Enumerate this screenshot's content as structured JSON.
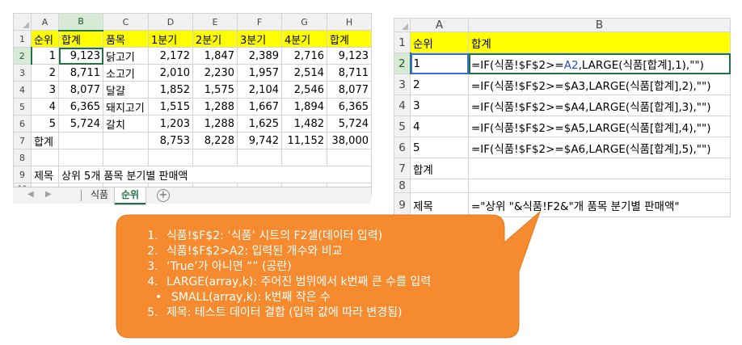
{
  "left_sheet": {
    "columns": [
      "A",
      "B",
      "C",
      "D",
      "E",
      "F",
      "G",
      "H"
    ],
    "rows": [
      {
        "num": "1",
        "cells": [
          "순위",
          "합계",
          "품목",
          "1분기",
          "2분기",
          "3분기",
          "4분기",
          "합계"
        ]
      },
      {
        "num": "2",
        "cells": [
          "1",
          "9,123",
          "닭고기",
          "2,172",
          "1,847",
          "2,389",
          "2,716",
          "9,123"
        ]
      },
      {
        "num": "3",
        "cells": [
          "2",
          "8,711",
          "소고기",
          "2,010",
          "2,230",
          "1,957",
          "2,514",
          "8,711"
        ]
      },
      {
        "num": "4",
        "cells": [
          "3",
          "8,077",
          "달걀",
          "1,852",
          "1,575",
          "2,104",
          "2,546",
          "8,077"
        ]
      },
      {
        "num": "5",
        "cells": [
          "4",
          "6,365",
          "돼지고기",
          "1,515",
          "1,288",
          "1,667",
          "1,894",
          "6,365"
        ]
      },
      {
        "num": "6",
        "cells": [
          "5",
          "5,724",
          "갈치",
          "1,203",
          "1,288",
          "1,625",
          "1,482",
          "5,724"
        ]
      },
      {
        "num": "7",
        "cells": [
          "합계",
          "",
          "",
          "8,753",
          "8,228",
          "9,742",
          "11,152",
          "38,000"
        ]
      },
      {
        "num": "8",
        "cells": [
          "",
          "",
          "",
          "",
          "",
          "",
          "",
          ""
        ]
      },
      {
        "num": "9",
        "cells": [
          "제목",
          "상위 5개 품목 분기별 판매액",
          "",
          "",
          "",
          "",
          "",
          ""
        ]
      },
      {
        "num": "10",
        "cells": [
          "",
          "",
          "",
          "",
          "",
          "",
          "",
          ""
        ]
      }
    ]
  },
  "tabs": {
    "items": [
      "식품",
      "순위"
    ],
    "active": "순위",
    "prev_icon": "◀",
    "next_icon": "▶",
    "add_icon": "+"
  },
  "right_sheet": {
    "columns": [
      "A",
      "B"
    ],
    "rows": [
      {
        "num": "1",
        "a": "순위",
        "b": "합계"
      },
      {
        "num": "2",
        "a": "1",
        "b_parts": [
          "=IF(식품!$F$2>=",
          "A2",
          ",LARGE(식품[합계],1),\"\")"
        ]
      },
      {
        "num": "3",
        "a": "2",
        "b": "=IF(식품!$F$2>=$A3,LARGE(식품[합계],2),\"\")"
      },
      {
        "num": "4",
        "a": "3",
        "b": "=IF(식품!$F$2>=$A4,LARGE(식품[합계],3),\"\")"
      },
      {
        "num": "5",
        "a": "4",
        "b": "=IF(식품!$F$2>=$A5,LARGE(식품[합계],4),\"\")"
      },
      {
        "num": "6",
        "a": "5",
        "b": "=IF(식품!$F$2>=$A6,LARGE(식품[합계],5),\"\")"
      },
      {
        "num": "7",
        "a": "합계",
        "b": ""
      },
      {
        "num": "8",
        "a": "",
        "b": ""
      },
      {
        "num": "9",
        "a": "제목",
        "b": "=\"상위 \"&식품!F2&\"개 품목 분기별 판매액\""
      }
    ]
  },
  "callout": {
    "fill": "#f58a2f",
    "items": [
      "식품!$F$2: ‘식품’ 시트의 F2셀(데이터 입력)",
      "식품!$F$2>A2: 입력된 개수와 비교",
      "‘True’가 아니면 “” (공란)",
      "LARGE(array,k): 주어진 범위에서 k번째 큰 수를 입력"
    ],
    "sub_item": "SMALL(array,k): k번째 작은 수",
    "last_item": "제목: 테스트 데이터 결합 (입력 값에 따라 변경됨)"
  }
}
